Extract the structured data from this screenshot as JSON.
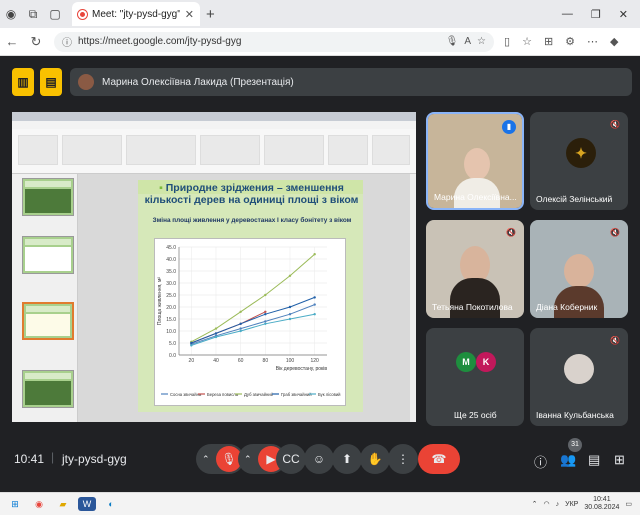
{
  "browser": {
    "tab_title": "Meet: \"jty-pysd-gyg\"",
    "url": "https://meet.google.com/jty-pysd-gyg"
  },
  "presentation_label": "Марина Олексіївна Лакида (Презентація)",
  "slide": {
    "heading": "Природне зріджения – зменшення кількості дерев на одиниці площі з віком",
    "subheading": "Зміна площі живлення у деревостанах І класу бонітету з віком",
    "chart_xlabel": "Вік деревостану, років",
    "chart_ylabel": "Площа живлення, м²"
  },
  "chart_data": {
    "type": "line",
    "title": "Зміна площі живлення у деревостанах І класу бонітету з віком",
    "xlabel": "Вік деревостану, років",
    "ylabel": "Площа живлення, м²",
    "x": [
      20,
      40,
      60,
      80,
      100,
      120
    ],
    "ylim": [
      0,
      45
    ],
    "series": [
      {
        "name": "Сосна звичайна",
        "color": "#4f81bd",
        "values": [
          4.5,
          8,
          11,
          14,
          17,
          21
        ]
      },
      {
        "name": "Береза повисла",
        "color": "#c0504d",
        "values": [
          5,
          9,
          13,
          18,
          null,
          null
        ]
      },
      {
        "name": "Дуб звичайний",
        "color": "#9bbb59",
        "values": [
          5.5,
          11,
          18,
          25,
          33,
          42
        ]
      },
      {
        "name": "Граб звичайний",
        "color": "#1f5fa8",
        "values": [
          5,
          9,
          13,
          17,
          20,
          24
        ]
      },
      {
        "name": "Бук лісовий",
        "color": "#4bacc6",
        "values": [
          4,
          7.5,
          10,
          13,
          15,
          17
        ]
      }
    ]
  },
  "participants": [
    {
      "name": "Марина Олексіївна...",
      "muted": false
    },
    {
      "name": "Олексій Зелінський",
      "muted": true
    },
    {
      "name": "Тетьяна Покотилова",
      "muted": true
    },
    {
      "name": "Діана Коберник",
      "muted": true
    },
    {
      "name": "Ще 25 осіб",
      "initials": [
        "M",
        "K"
      ]
    },
    {
      "name": "Іванна Кульбанська",
      "muted": true
    }
  ],
  "controls": {
    "time": "10:41",
    "code": "jty-pysd-gyg",
    "participant_count": "31"
  },
  "taskbar": {
    "lang": "УКР",
    "time": "10:41",
    "date": "30.08.2024"
  },
  "colors": {
    "meet_bg": "#202124",
    "accent": "#f9c100",
    "end_call": "#ea4335"
  }
}
